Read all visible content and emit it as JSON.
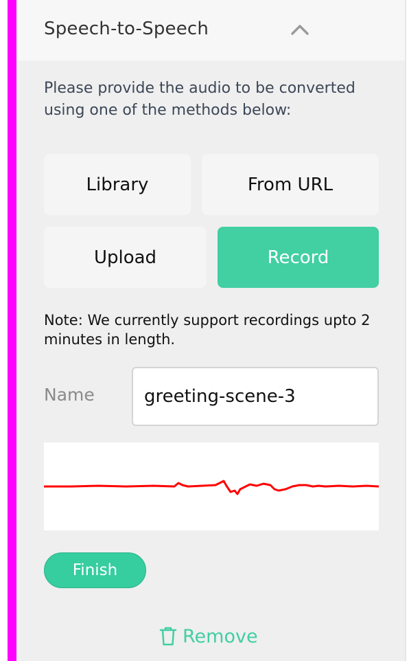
{
  "header": {
    "title": "Speech-to-Speech",
    "collapse_icon": "chevron-up-icon"
  },
  "description": "Please provide the audio to be converted using one of the methods below:",
  "methods": [
    {
      "label": "Library",
      "selected": false
    },
    {
      "label": "From URL",
      "selected": false
    },
    {
      "label": "Upload",
      "selected": false
    },
    {
      "label": "Record",
      "selected": true
    }
  ],
  "note": "Note: We currently support recordings upto 2 minutes in length.",
  "name_field": {
    "label": "Name",
    "value": "greeting-scene-3"
  },
  "waveform_icon": "audio-waveform",
  "finish_label": "Finish",
  "remove": {
    "label": "Remove",
    "icon": "trash-icon"
  },
  "colors": {
    "accent_bar": "#ff00ff",
    "primary": "#42cfa2",
    "waveform": "#ff0000"
  }
}
